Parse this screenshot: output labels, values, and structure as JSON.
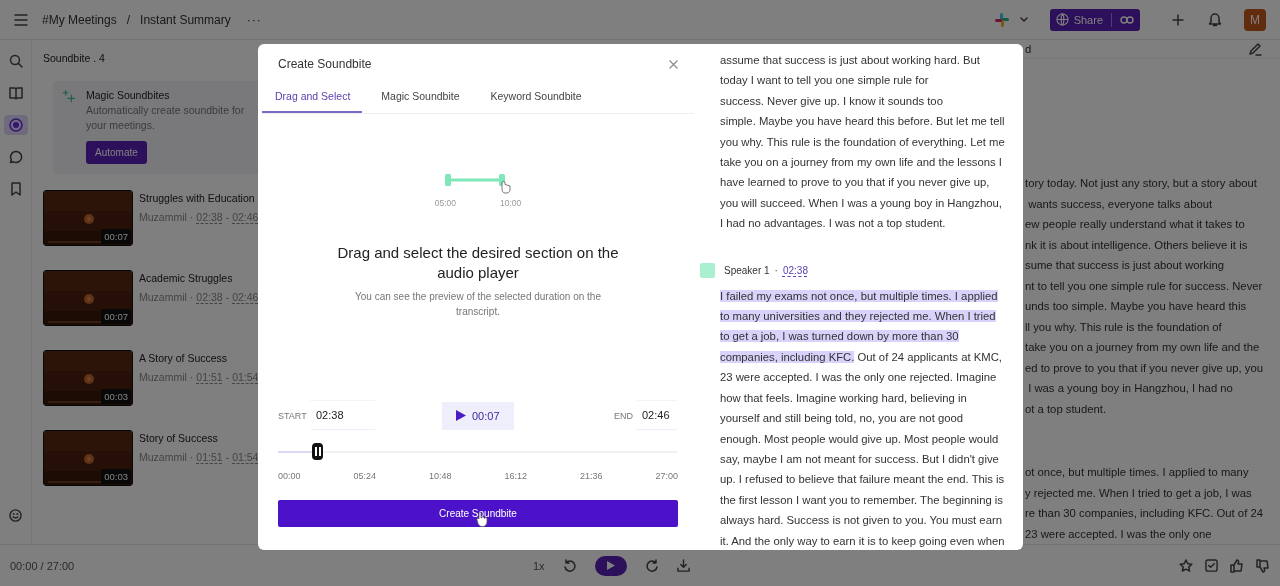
{
  "topbar": {
    "breadcrumb": [
      {
        "label": "#My Meetings"
      },
      {
        "label": "Instant Summary"
      }
    ],
    "separator": "/",
    "more": "···",
    "share_button": "Share",
    "avatar": "M"
  },
  "rail_items": [
    {
      "kind": "search",
      "selected": false
    },
    {
      "kind": "book",
      "selected": false
    },
    {
      "kind": "target",
      "selected": true
    },
    {
      "kind": "chat",
      "selected": false
    },
    {
      "kind": "bookmark",
      "selected": false
    }
  ],
  "soundbites_panel": {
    "title": "Soundbite . 4",
    "promo": {
      "title": "Magic Soundbites",
      "text": "Automatically create soundbite for your meetings.",
      "button": "Automate"
    },
    "meta_separator": "·",
    "range_separator": "-",
    "items": [
      {
        "title": "Struggles with Education",
        "author": "Muzammil",
        "start": "02:38",
        "end": "02:46",
        "duration": "00:07"
      },
      {
        "title": "Academic Struggles",
        "author": "Muzammil",
        "start": "02:38",
        "end": "02:46",
        "duration": "00:07"
      },
      {
        "title": "A Story of Success",
        "author": "Muzammil",
        "start": "01:51",
        "end": "01:54",
        "duration": "00:03"
      },
      {
        "title": "Story of Success",
        "author": "Muzammil",
        "start": "01:51",
        "end": "01:54",
        "duration": "00:03"
      }
    ]
  },
  "page_header_fragment": "d",
  "page_transcript": [
    {
      "lines": "tory today. Not just any story, but a story about\n wants success, everyone talks about\new people really understand what it takes to\nnk it is about intelligence. Others believe it is\nsume that success is just about working\nnt to tell you one simple rule for success. Never\nunds too simple. Maybe you have heard this\nll you why. This rule is the foundation of\ntake you on a journey from my own life and the\ned to prove to you that if you never give up, you\n I was a young boy in Hangzhou, I had no\not a top student."
    },
    {
      "lines": "ot once, but multiple times. I applied to many\ny rejected me. When I tried to get a job, I was\nre than 30 companies, including KFC. Out of 24\n23 were accepted. I was the only one"
    }
  ],
  "modal": {
    "title": "Create Soundbite",
    "tabs": [
      {
        "label": "Drag and Select",
        "selected": true
      },
      {
        "label": "Magic Soundbite",
        "selected": false
      },
      {
        "label": "Keyword Soundbite",
        "selected": false
      }
    ],
    "illustration_labels": [
      "05:00",
      "10:00"
    ],
    "heading": "Drag and select the desired section on the audio player",
    "description": "You can see the preview of the selected duration on the transcript.",
    "start_label": "START",
    "start_value": "02:38",
    "duration": "00:07",
    "end_label": "END",
    "end_value": "02:46",
    "slider": {
      "level": 0.1
    },
    "ticks": [
      "00:00",
      "05:24",
      "10:48",
      "16:12",
      "21:36",
      "27:00"
    ],
    "create_button": "Create Soundbite",
    "transcript": [
      {
        "kind": "text",
        "segments": [
          {
            "text": "assume that success is just about working hard. But\ntoday I want to tell you one simple rule for\nsuccess. Never give up. I know it sounds too\nsimple. Maybe you have heard this before. But let me tell\nyou why. This rule is the foundation of everything. Let me\ntake you on a journey from my own life and the lessons I\nhave learned to prove to you that if you never give up,\nyou will succeed. When I was a young boy in Hangzhou,\nI had no advantages. I was not a top student.",
            "highlighted": false
          }
        ]
      },
      {
        "kind": "speaker",
        "name": "Speaker 1",
        "separator": "·",
        "time": "02:38"
      },
      {
        "kind": "text",
        "segments": [
          {
            "text": "I failed my exams not once, but multiple times. I applied\nto many universities and they rejected me. When I tried\nto get a job, I was turned down by more than 30\ncompanies, including KFC.",
            "highlighted": true
          },
          {
            "text": " Out of 24 applicants at KMC,\n23 were accepted. I was the only one rejected. Imagine\nhow that feels. Imagine working hard, believing in\nyourself and still being told, no, you are not good\nenough. Most people would give up. Most people would\nsay, maybe I am not meant for success. But I didn't give\nup. I refused to believe that failure meant the end. This is\nthe first lesson I want you to remember. The beginning is\nalways hard. Success is not given to you. You must earn\nit. And the only way to earn it is to keep going even when",
            "highlighted": false
          }
        ]
      }
    ]
  },
  "player": {
    "time": "00:00 / 27:00",
    "speed": "1x"
  }
}
